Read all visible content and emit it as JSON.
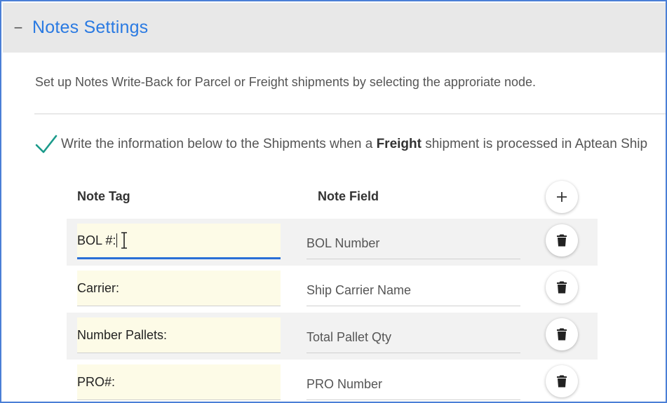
{
  "section": {
    "collapse_symbol": "−",
    "title": "Notes Settings",
    "description": "Set up Notes Write-Back for Parcel or Freight shipments by selecting the approriate node."
  },
  "writeback": {
    "checked": true,
    "text_before": "Write the information below to the Shipments when a ",
    "text_bold": "Freight",
    "text_after": " shipment is processed in Aptean Ship"
  },
  "columns": {
    "note_tag": "Note Tag",
    "note_field": "Note Field"
  },
  "icons": {
    "collapse": "minus-icon",
    "check": "checkmark-icon",
    "add": "plus-icon",
    "delete": "trash-icon",
    "cursor": "text-cursor-icon"
  },
  "colors": {
    "accent": "#2a7ae2",
    "check": "#1a9a8a",
    "input_bg": "#fdfbe7",
    "row_shade": "#f2f2f2"
  },
  "rows": [
    {
      "tag": "BOL #:",
      "field": "BOL Number"
    },
    {
      "tag": "Carrier:",
      "field": "Ship Carrier Name"
    },
    {
      "tag": "Number Pallets:",
      "field": "Total Pallet Qty"
    },
    {
      "tag": "PRO#:",
      "field": "PRO Number"
    }
  ]
}
